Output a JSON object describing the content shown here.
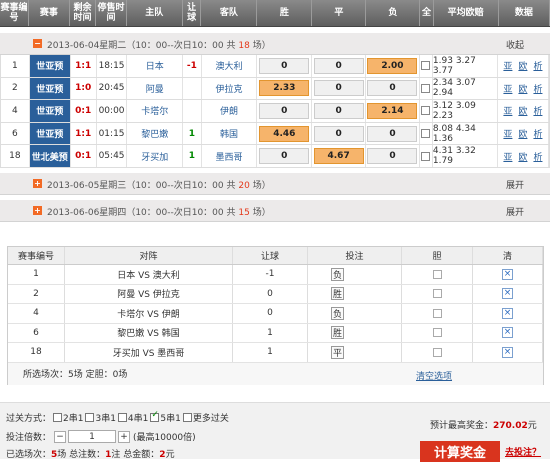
{
  "headers": [
    "赛事编号",
    "赛事",
    "剩余时间",
    "停售时间",
    "主队",
    "让球",
    "客队",
    "胜",
    "平",
    "负",
    "全",
    "平均欧赔",
    "数据"
  ],
  "days": [
    {
      "date": "2013-06-04星期二",
      "time_text": "（10：00--次日10：00 共",
      "count": "18",
      "unit": "场）",
      "toggle": "−",
      "right": "收起",
      "matches": [
        {
          "id": "1",
          "league": "世亚预",
          "score": "1:1",
          "time": "18:15",
          "home": "日本",
          "handicap": "-1",
          "hsign": "neg",
          "away": "澳大利",
          "win": "0",
          "draw": "0",
          "lose": "2.00",
          "sel": "lose",
          "avg": "1.93 3.27 3.77",
          "link1": "亚",
          "link2": "欧",
          "link3": "析"
        },
        {
          "id": "2",
          "league": "世亚预",
          "score": "1:0",
          "time": "20:45",
          "home": "阿曼",
          "handicap": "",
          "hsign": "",
          "away": "伊拉克",
          "win": "2.33",
          "draw": "0",
          "lose": "0",
          "sel": "win",
          "avg": "2.34 3.07 2.94",
          "link1": "亚",
          "link2": "欧",
          "link3": "析"
        },
        {
          "id": "4",
          "league": "世亚预",
          "score": "0:1",
          "time": "00:00",
          "home": "卡塔尔",
          "handicap": "",
          "hsign": "",
          "away": "伊朗",
          "win": "0",
          "draw": "0",
          "lose": "2.14",
          "sel": "lose",
          "avg": "3.12 3.09 2.23",
          "link1": "亚",
          "link2": "欧",
          "link3": "析"
        },
        {
          "id": "6",
          "league": "世亚预",
          "score": "1:1",
          "time": "01:15",
          "home": "黎巴嫩",
          "handicap": "1",
          "hsign": "pos",
          "away": "韩国",
          "win": "4.46",
          "draw": "0",
          "lose": "0",
          "sel": "win",
          "avg": "8.08 4.34 1.36",
          "link1": "亚",
          "link2": "欧",
          "link3": "析"
        },
        {
          "id": "18",
          "league": "世北美预",
          "score": "0:1",
          "time": "05:45",
          "home": "牙买加",
          "handicap": "1",
          "hsign": "pos",
          "away": "墨西哥",
          "win": "0",
          "draw": "4.67",
          "lose": "0",
          "sel": "draw",
          "avg": "4.31 3.32 1.79",
          "link1": "亚",
          "link2": "欧",
          "link3": "析"
        }
      ]
    },
    {
      "date": "2013-06-05星期三",
      "time_text": "（10：00--次日10：00 共",
      "count": "20",
      "unit": "场）",
      "toggle": "+",
      "right": "展开",
      "matches": []
    },
    {
      "date": "2013-06-06星期四",
      "time_text": "（10：00--次日10：00 共",
      "count": "15",
      "unit": "场）",
      "toggle": "+",
      "right": "展开",
      "matches": []
    }
  ],
  "panel": {
    "headers": [
      "赛事编号",
      "对阵",
      "让球",
      "投注",
      "胆",
      "清"
    ],
    "rows": [
      {
        "id": "1",
        "match": "日本 VS 澳大利",
        "hcap": "-1",
        "bet": "负"
      },
      {
        "id": "2",
        "match": "阿曼 VS 伊拉克",
        "hcap": "0",
        "bet": "胜"
      },
      {
        "id": "4",
        "match": "卡塔尔 VS 伊朗",
        "hcap": "0",
        "bet": "负"
      },
      {
        "id": "6",
        "match": "黎巴嫩 VS 韩国",
        "hcap": "1",
        "bet": "胜"
      },
      {
        "id": "18",
        "match": "牙买加 VS 墨西哥",
        "hcap": "1",
        "bet": "平"
      }
    ],
    "footer": "所选场次：5场  定胆：0场",
    "clear": "清空选项"
  },
  "bottom": {
    "pass_label": "过关方式：",
    "pass_opts": [
      {
        "label": "2串1",
        "on": false
      },
      {
        "label": "3串1",
        "on": false
      },
      {
        "label": "4串1",
        "on": false
      },
      {
        "label": "5串1",
        "on": true
      },
      {
        "label": "更多过关",
        "on": false
      }
    ],
    "mult_label": "投注倍数：",
    "mult_value": "1",
    "mult_note": "(最高10000倍)",
    "sel_label": "已选场次：",
    "sel_count": "5",
    "sel_unit": "场  总注数：",
    "notes": "1",
    "notes_unit": "注  总金额：",
    "amount": "2",
    "amount_unit": "元",
    "prize_label": "预计最高奖金：",
    "prize_value": "270.02",
    "prize_unit": "元",
    "calc": "计算奖金",
    "bet": "去投注？"
  }
}
